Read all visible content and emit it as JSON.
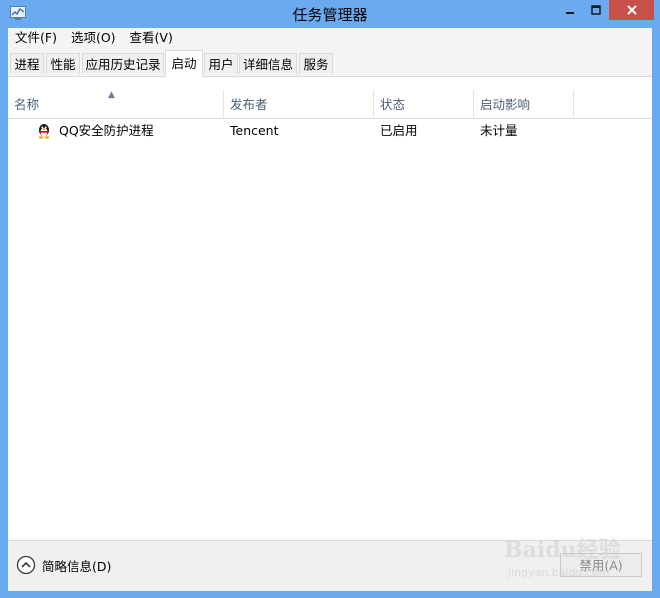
{
  "window": {
    "title": "任务管理器"
  },
  "menu": [
    "文件(F)",
    "选项(O)",
    "查看(V)"
  ],
  "tabs": [
    {
      "label": "进程",
      "active": false
    },
    {
      "label": "性能",
      "active": false
    },
    {
      "label": "应用历史记录",
      "active": false
    },
    {
      "label": "启动",
      "active": true
    },
    {
      "label": "用户",
      "active": false
    },
    {
      "label": "详细信息",
      "active": false
    },
    {
      "label": "服务",
      "active": false
    }
  ],
  "columns": {
    "name": "名称",
    "publisher": "发布者",
    "status": "状态",
    "impact": "启动影响"
  },
  "rows": [
    {
      "name": "QQ安全防护进程",
      "publisher": "Tencent",
      "status": "已启用",
      "impact": "未计量",
      "icon": "qq-penguin-icon"
    }
  ],
  "footer": {
    "fewer_details": "简略信息(D)",
    "disable_button": "禁用(A)"
  },
  "watermark": {
    "line1": "Baidu经验",
    "line2": "jingyan.baidu.com"
  },
  "colors": {
    "window_frame": "#6aaaf0",
    "close_button": "#c7504a",
    "header_text": "#4c607a"
  }
}
